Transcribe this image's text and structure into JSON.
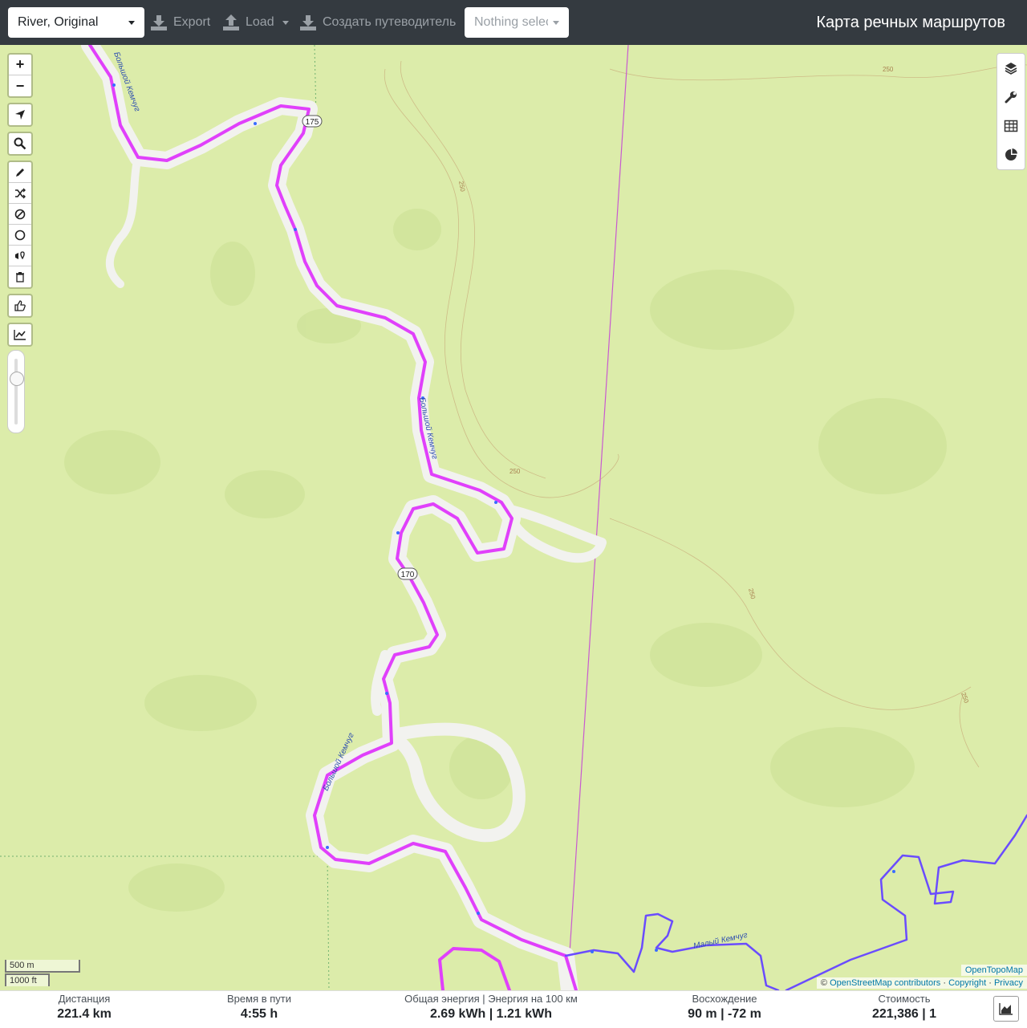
{
  "header": {
    "profile_value": "River, Original",
    "export_label": "Export",
    "load_label": "Load",
    "guide_label": "Создать путеводитель",
    "selection_value": "Nothing selected",
    "app_title": "Карта речных маршрутов"
  },
  "map": {
    "river_label_1": "Большой Кемчуг",
    "river_label_2": "Большой Кемчуг",
    "river_label_3": "Большой Кемчуг",
    "river_label_4": "Малый Кемчуг",
    "marker_175": "175",
    "marker_170": "170",
    "contour_250_a": "250",
    "contour_250_b": "250",
    "contour_250_c": "250",
    "contour_250_d": "250",
    "contour_250_e": "250",
    "route_color": "#e040fb",
    "side_route_color": "#6a4cff"
  },
  "controls": {
    "zoom_in": "+",
    "zoom_out": "−",
    "icons": [
      "locate-icon",
      "search-icon",
      "pencil-icon",
      "shuffle-icon",
      "no-entry-icon",
      "circle-icon",
      "poi-icon",
      "trash-icon",
      "thumb-icon",
      "chart-icon"
    ],
    "right_icons": [
      "layers-icon",
      "wrench-icon",
      "table-icon",
      "pie-chart-icon"
    ]
  },
  "scale": {
    "metric": "500 m",
    "imperial": "1000 ft"
  },
  "attribution": {
    "provider": "OpenTopoMap",
    "prefix": "©",
    "osm": "OpenStreetMap contributors",
    "copyright": "Copyright",
    "privacy": "Privacy",
    "sep": "·"
  },
  "stats": {
    "distance_label": "Дистанция",
    "distance_value": "221.4 km",
    "time_label": "Время в пути",
    "time_value": "4:55 h",
    "energy_label": "Общая энергия | Энергия на 100 км",
    "energy_value": "2.69 kWh | 1.21 kWh",
    "ascent_label": "Восхождение",
    "ascent_value": "90 m | -72 m",
    "cost_label": "Стоимость",
    "cost_value": "221,386 | 1"
  }
}
